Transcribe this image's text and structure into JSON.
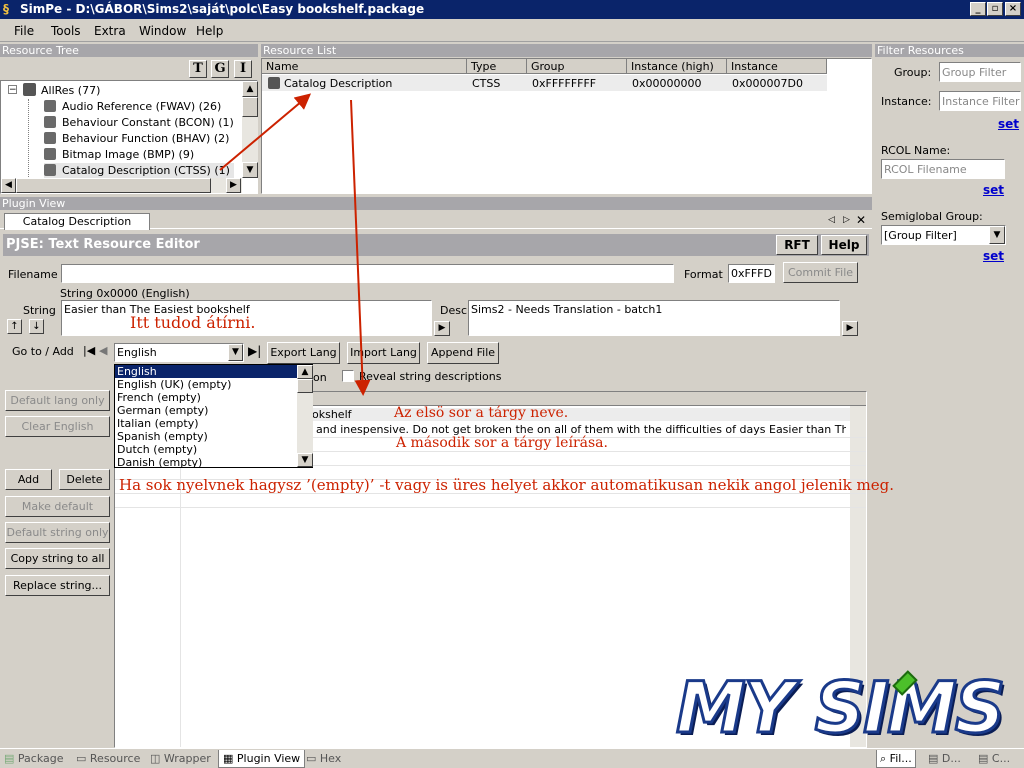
{
  "window": {
    "title": "SimPe - D:\\GÁBOR\\Sims2\\saját\\polc\\Easy bookshelf.package"
  },
  "menu": [
    "File",
    "Tools",
    "Extra",
    "Window",
    "Help"
  ],
  "resource_tree": {
    "header": "Resource Tree",
    "toolbar": [
      "T",
      "G",
      "I"
    ],
    "root": "AllRes (77)",
    "items": [
      "Audio Reference (FWAV) (26)",
      "Behaviour Constant (BCON) (1)",
      "Behaviour Function (BHAV) (2)",
      "Bitmap Image (BMP) (9)",
      "Catalog Description (CTSS) (1)"
    ]
  },
  "resource_list": {
    "header": "Resource List",
    "columns": [
      "Name",
      "Type",
      "Group",
      "Instance (high)",
      "Instance"
    ],
    "rows": [
      [
        "Catalog Description",
        "CTSS",
        "0xFFFFFFFF",
        "0x00000000",
        "0x000007D0"
      ]
    ]
  },
  "filter": {
    "header": "Filter Resources",
    "group_label": "Group:",
    "group_placeholder": "Group Filter",
    "instance_label": "Instance:",
    "instance_placeholder": "Instance Filter",
    "set1": "set",
    "rcol_label": "RCOL Name:",
    "rcol_placeholder": "RCOL Filename",
    "set2": "set",
    "semiglobal_label": "Semiglobal Group:",
    "semiglobal_value": "[Group Filter]",
    "set3": "set"
  },
  "plugin": {
    "header": "Plugin View",
    "tab": "Catalog Description",
    "editor_title": "PJSE: Text Resource Editor",
    "rft": "RFT",
    "help": "Help",
    "filename_label": "Filename",
    "filename_value": "",
    "format_label": "Format",
    "format_value": "0xFFFD",
    "commit": "Commit File",
    "string_label": "String",
    "string_header": "String 0x0000 (English)",
    "string_value": "Easier than The Easiest bookshelf",
    "desc_label": "Desc",
    "desc_value": "Sims2 - Needs Translation - batch1",
    "goto_label": "Go to / Add",
    "lang_selected": "English",
    "export": "Export Lang",
    "import": "Import Lang",
    "append": "Append File",
    "checkbox_partial": "on",
    "reveal": "Reveal string descriptions",
    "dropdown_options": [
      "English",
      "English (UK) (empty)",
      "French (empty)",
      "German (empty)",
      "Italian (empty)",
      "Spanish (empty)",
      "Dutch (empty)",
      "Danish (empty)"
    ],
    "row1_text": "okshelf",
    "row2_text": "and inespensive. Do not get broken the on all of them with the difficulties of days Easier than The Easiest ...",
    "buttons": {
      "default_lang": "Default lang only",
      "clear_english": "Clear English",
      "add": "Add",
      "delete": "Delete",
      "make_default": "Make default",
      "default_string": "Default string only",
      "copy_string": "Copy string to all",
      "replace_string": "Replace string..."
    }
  },
  "annotations": {
    "edit_here": "Itt tudod átírni.",
    "first_row": "Az elsö sor a tárgy neve.",
    "second_row": "A második sor a tárgy leírása.",
    "empty_note": "Ha sok nyelvnek hagysz ’(empty)’ -t vagy is üres helyet akkor automatikusan nekik angol jelenik meg."
  },
  "logo": "MY SIMS",
  "bottom_tabs": [
    "Package",
    "Resource",
    "Wrapper",
    "Plugin View",
    "Hex"
  ],
  "bottom_right_tabs": [
    "Fil...",
    "D...",
    "C..."
  ],
  "colors": {
    "title_bar": "#0a246a",
    "selection": "#0a246a",
    "annotation_red": "#cc2200",
    "link_blue": "#0000cc"
  }
}
